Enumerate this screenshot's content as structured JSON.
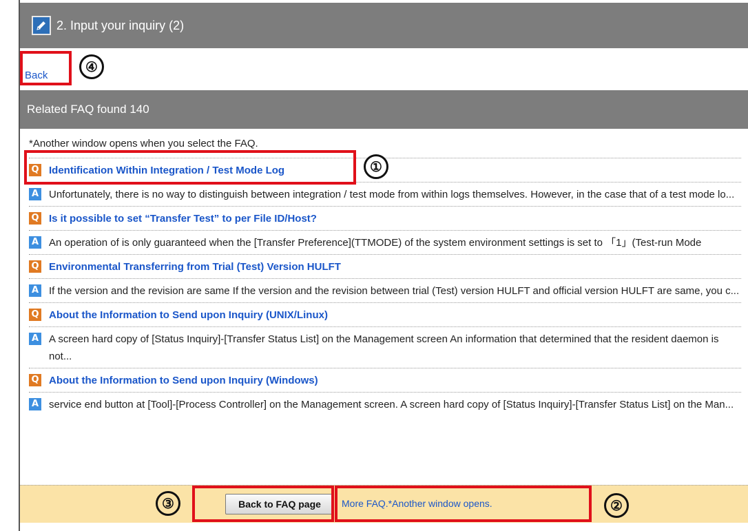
{
  "header": {
    "title": "2. Input your inquiry (2)",
    "icon": "pencil-icon"
  },
  "back_link": "Back",
  "subheader": "Related FAQ found 140",
  "note": "*Another window opens when you select the FAQ.",
  "faqs": [
    {
      "question": "Identification Within Integration / Test Mode Log",
      "answer": "Unfortunately, there is no way to distinguish between integration / test mode from within logs themselves. However, in the case that of a test mode lo..."
    },
    {
      "question": "Is it possible to set “Transfer Test” to per File ID/Host?",
      "answer": "An operation of is only guaranteed when the [Transfer Preference](TTMODE) of the system environment settings is set to 「1」(Test-run Mode"
    },
    {
      "question": "Environmental Transferring from Trial (Test) Version HULFT",
      "answer": "If the version and the revision are same If the version and the revision between trial (Test) version HULFT and official version HULFT are same, you c..."
    },
    {
      "question": "About the Information to Send upon Inquiry (UNIX/Linux)",
      "answer": "A screen hard copy of [Status Inquiry]-[Transfer Status List] on the Management screen An information that determined that the resident daemon is not..."
    },
    {
      "question": "About the Information to Send upon Inquiry (Windows)",
      "answer": "service end button at [Tool]-[Process Controller] on the Management screen. A screen hard copy of [Status Inquiry]-[Transfer Status List] on the Man..."
    }
  ],
  "badges": {
    "q": "Q",
    "a": "A"
  },
  "footer": {
    "button_label": "Back to FAQ page",
    "more_link": "More FAQ.*Another window opens."
  },
  "annotations": [
    "①",
    "②",
    "③",
    "④"
  ],
  "colors": {
    "header_bg": "#7d7d7d",
    "link": "#1a56c9",
    "q_badge": "#e07a23",
    "a_badge": "#3d8fe0",
    "footer_bg": "#fbe3a7",
    "annotation_box": "#e0101a"
  }
}
